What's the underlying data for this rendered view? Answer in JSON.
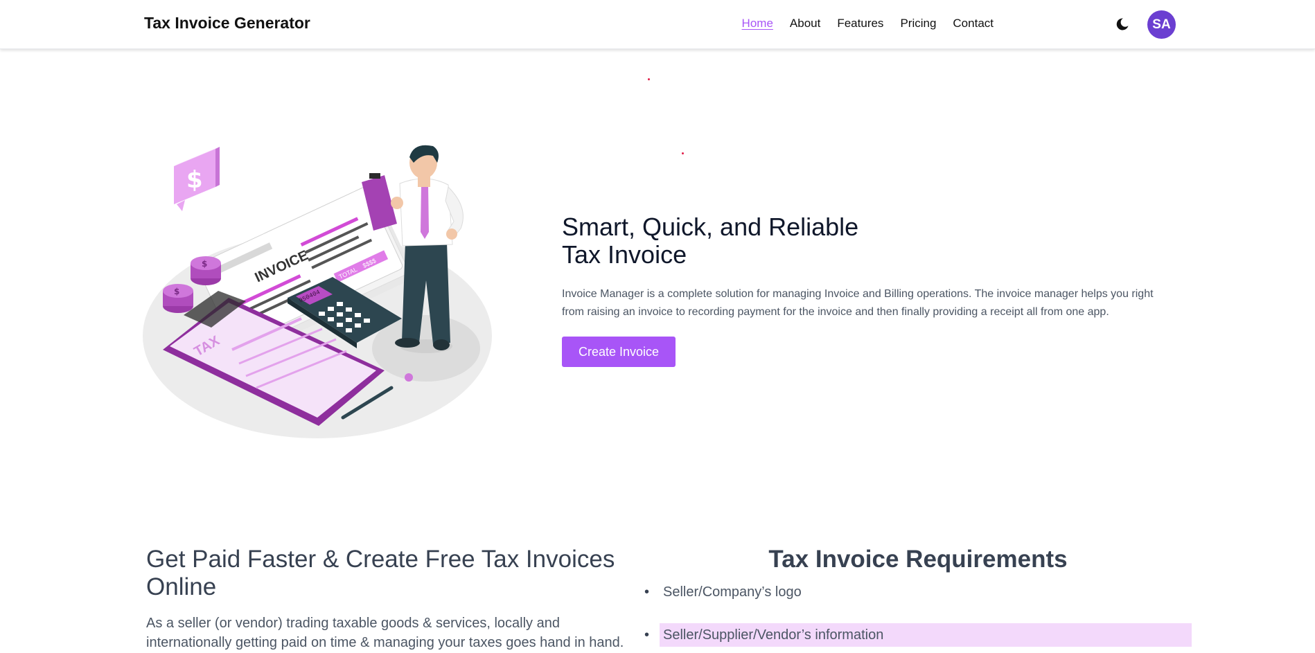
{
  "header": {
    "brand": "Tax Invoice Generator",
    "nav": [
      {
        "label": "Home",
        "active": true
      },
      {
        "label": "About",
        "active": false
      },
      {
        "label": "Features",
        "active": false
      },
      {
        "label": "Pricing",
        "active": false
      },
      {
        "label": "Contact",
        "active": false
      }
    ],
    "theme_icon": "moon-icon",
    "avatar_initials": "SA"
  },
  "hero": {
    "title_line1": "Smart, Quick, and Reliable",
    "title_line2": "Tax Invoice",
    "description": "Invoice Manager is a complete solution for managing Invoice and Billing operations. The invoice manager helps you right from raising an invoice to recording payment for the invoice and then finally providing a receipt all from one app.",
    "cta_label": "Create Invoice",
    "illustration": {
      "invoice_label": "INVOICE",
      "total_label": "TOTAL",
      "total_value": "$$$$",
      "tax_label": "TAX",
      "calculator_display": "950404",
      "dollar_symbol": "$"
    }
  },
  "section": {
    "left_title": "Get Paid Faster & Create Free Tax Invoices Online",
    "left_desc": "As a seller (or vendor) trading taxable goods & services, locally and internationally getting paid on time & managing your taxes goes hand in hand.",
    "right_title": "Tax Invoice Requirements",
    "requirements": [
      "Seller/Company’s logo",
      "Seller/Supplier/Vendor’s information"
    ]
  },
  "colors": {
    "accent": "#a855f7",
    "avatar_bg": "#6b3fd1",
    "highlight_bg": "#f3d9fb"
  }
}
